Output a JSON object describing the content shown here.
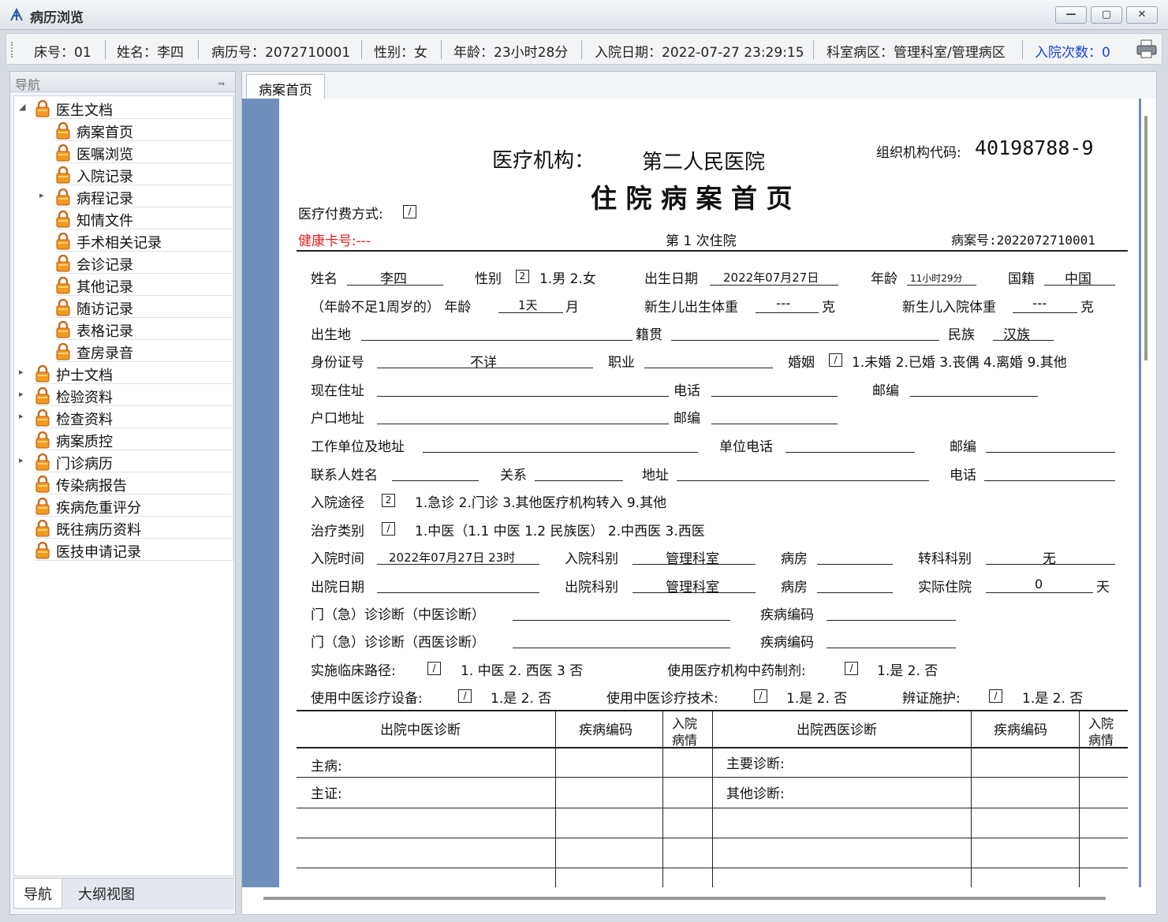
{
  "window": {
    "title": "病历浏览",
    "min": "—",
    "max": "▢",
    "close": "✕"
  },
  "info": {
    "bed": "床号：01",
    "name": "姓名：李四",
    "record_no": "病历号：2072710001",
    "sex": "性别：女",
    "age": "年龄：23小时28分",
    "admit_date": "入院日期：2022-07-27 23:29:15",
    "dept": "科室病区：管理科室/管理病区",
    "admit_count": "入院次数：0",
    "print_icon": "printer-icon"
  },
  "nav": {
    "title": "导航",
    "pin": "ᆿ",
    "tabs": [
      "导航",
      "大纲视图"
    ],
    "items": [
      {
        "label": "医生文档",
        "expander": "◢"
      },
      {
        "label": "病案首页"
      },
      {
        "label": "医嘱浏览"
      },
      {
        "label": "入院记录"
      },
      {
        "label": "病程记录",
        "expander": "▸"
      },
      {
        "label": "知情文件"
      },
      {
        "label": "手术相关记录"
      },
      {
        "label": "会诊记录"
      },
      {
        "label": "其他记录"
      },
      {
        "label": "随访记录"
      },
      {
        "label": "表格记录"
      },
      {
        "label": "查房录音"
      },
      {
        "label": "护士文档",
        "expander": "▸"
      },
      {
        "label": "检验资料",
        "expander": "▸"
      },
      {
        "label": "检查资料",
        "expander": "▸"
      },
      {
        "label": "病案质控"
      },
      {
        "label": "门诊病历",
        "expander": "▸"
      },
      {
        "label": "传染病报告"
      },
      {
        "label": "疾病危重评分"
      },
      {
        "label": "既往病历资料"
      },
      {
        "label": "医技申请记录"
      }
    ]
  },
  "doc": {
    "tab": "病案首页",
    "institution_label": "医疗机构：",
    "institution": "第二人民医院",
    "org_code_label": "组织机构代码:",
    "org_code": "40198788-9",
    "title": "住 院 病 案 首 页",
    "pay_method": "医疗付费方式:",
    "pay_box": "/",
    "health_card": "健康卡号:---",
    "visit_times": "第 1 次住院",
    "case_no": "病案号:2022072710001",
    "r1": {
      "name_l": "姓名",
      "name_v": "李四",
      "sex_l": "性别",
      "sex_box": "2",
      "sex_opts": "1.男  2.女",
      "birth_l": "出生日期",
      "birth_v": "2022年07月27日",
      "age_l": "年龄",
      "age_v": "11小时29分",
      "nat_l": "国籍",
      "nat_v": "中国"
    },
    "r2": {
      "infant_l": "（年龄不足1周岁的） 年龄",
      "infant_v": "1天",
      "month": "月",
      "bw_l": "新生儿出生体重",
      "bw_v": "---",
      "g1": "克",
      "aw_l": "新生儿入院体重",
      "aw_v": "---",
      "g2": "克"
    },
    "r3": {
      "birthplace": "出生地",
      "native": "籍贯",
      "ethnic_l": "民族",
      "ethnic_v": "汉族"
    },
    "r4": {
      "id_l": "身份证号",
      "id_v": "不详",
      "job_l": "职业",
      "mar_l": "婚姻",
      "mar_box": "/",
      "mar_opts": "1.未婚 2.已婚 3.丧偶 4.离婚 9.其他"
    },
    "r5": {
      "addr_l": "现在住址",
      "tel_l": "电话",
      "zip_l": "邮编"
    },
    "r6": {
      "hukou_l": "户口地址",
      "zip_l": "邮编"
    },
    "r7": {
      "work_l": "工作单位及地址",
      "wtel_l": "单位电话",
      "zip_l": "邮编"
    },
    "r8": {
      "contact_l": "联系人姓名",
      "rel_l": "关系",
      "addr_l": "地址",
      "tel_l": "电话"
    },
    "r9": {
      "route_l": "入院途径",
      "route_box": "2",
      "route_opts": "1.急诊   2.门诊   3.其他医疗机构转入   9.其他"
    },
    "r10": {
      "treat_l": "治疗类别",
      "treat_box": "/",
      "treat_opts": "1.中医（1.1  中医   1.2  民族医）   2.中西医    3.西医"
    },
    "r11": {
      "in_time_l": "入院时间",
      "in_time_v": "2022年07月27日  23时",
      "in_dept_l": "入院科别",
      "in_dept_v": "管理科室",
      "ward_l": "病房",
      "trans_l": "转科科别",
      "trans_v": "无"
    },
    "r12": {
      "out_l": "出院日期",
      "out_dept_l": "出院科别",
      "out_dept_v": "管理科室",
      "ward_l": "病房",
      "stay_l": "实际住院",
      "stay_v": "0",
      "day": "天"
    },
    "r13": {
      "tcm_l": "门（急）诊诊断（中医诊断）",
      "code_l": "疾病编码"
    },
    "r14": {
      "wm_l": "门（急）诊诊断（西医诊断）",
      "code_l": "疾病编码"
    },
    "r15": {
      "path_l": "实施临床路径:",
      "path_box": "/",
      "path_opts": "1.  中医   2.  西医   3  否",
      "prep_l": "使用医疗机构中药制剂:",
      "prep_box": "/",
      "prep_opts": "1.是   2.  否"
    },
    "r16": {
      "equip_l": "使用中医诊疗设备:",
      "equip_box": "/",
      "equip_opts": "1.是  2.  否",
      "tech_l": "使用中医诊疗技术:",
      "tech_box": "/",
      "tech_opts": "1.是  2.  否",
      "care_l": "辨证施护:",
      "care_box": "/",
      "care_opts": "1.是  2.  否"
    },
    "table": {
      "h_tcm": "出院中医诊断",
      "h_code1": "疾病编码",
      "h_cond1a": "入院",
      "h_cond1b": "病情",
      "h_wm": "出院西医诊断",
      "h_code2": "疾病编码",
      "h_cond2a": "入院",
      "h_cond2b": "病情",
      "main_disease": "主病:",
      "main_syndrome": "主证:",
      "main_diag": "主要诊断:",
      "other_diag": "其他诊断:"
    }
  }
}
